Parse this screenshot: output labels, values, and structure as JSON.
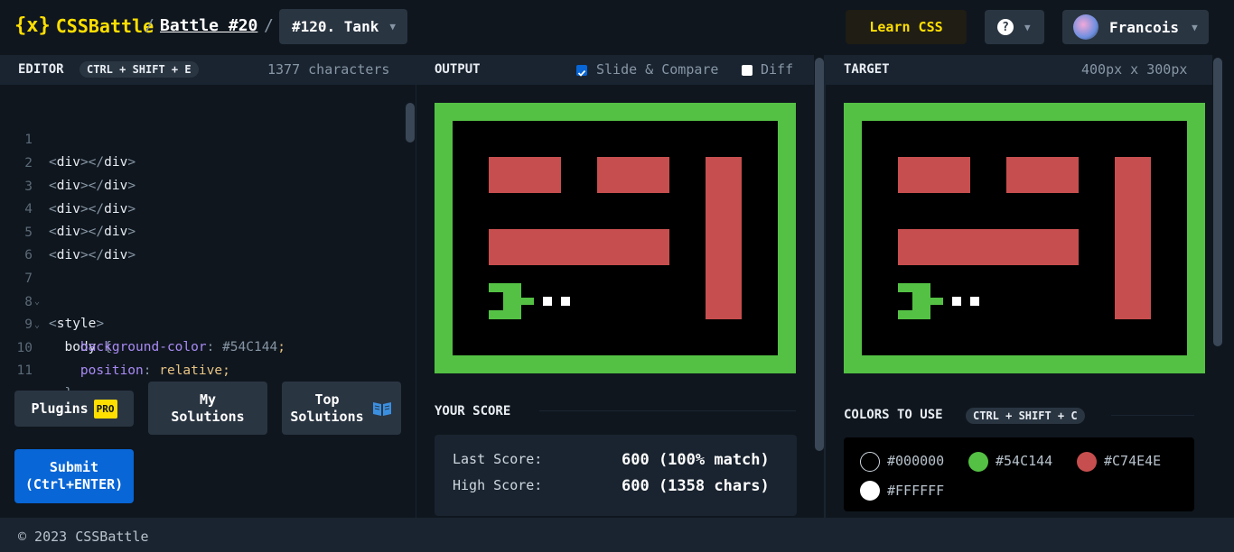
{
  "header": {
    "logo_mark": "{x}",
    "logo_text": "CSSBattle",
    "separator": "/",
    "battle_link": "Battle #20",
    "target_select": "#120. Tank",
    "learn_css": "Learn CSS",
    "help_icon": "?",
    "user_name": "Francois"
  },
  "editor": {
    "title": "EDITOR",
    "shortcut": "CTRL + SHIFT + E",
    "char_count": "1377 characters",
    "lines": [
      {
        "n": "1",
        "tag": "div"
      },
      {
        "n": "2",
        "tag": "div"
      },
      {
        "n": "3",
        "tag": "div"
      },
      {
        "n": "4",
        "tag": "div"
      },
      {
        "n": "5",
        "tag": "div"
      },
      {
        "n": "6"
      },
      {
        "n": "7",
        "style_open": "style"
      },
      {
        "n": "8",
        "selector": "body",
        "brace": "{"
      },
      {
        "n": "9",
        "prop": "background-color",
        "value": "#54C144",
        "end": ";"
      },
      {
        "n": "10",
        "prop": "position",
        "value": "relative",
        "end": ";"
      },
      {
        "n": "11",
        "brace_close": "}"
      }
    ]
  },
  "buttons": {
    "plugins": "Plugins",
    "pro_badge": "PRO",
    "my_solutions_l1": "My",
    "my_solutions_l2": "Solutions",
    "top_solutions_l1": "Top",
    "top_solutions_l2": "Solutions",
    "submit_l1": "Submit",
    "submit_l2": "(Ctrl+ENTER)"
  },
  "output": {
    "title": "OUTPUT",
    "slide_compare": "Slide & Compare",
    "slide_compare_checked": true,
    "diff": "Diff",
    "diff_checked": false
  },
  "target": {
    "title": "TARGET",
    "size": "400px x 300px"
  },
  "score": {
    "title": "YOUR SCORE",
    "last_label": "Last Score:",
    "last_value": "600 (100% match)",
    "high_label": "High Score:",
    "high_value": "600 (1358 chars)"
  },
  "colors": {
    "title": "COLORS TO USE",
    "shortcut": "CTRL + SHIFT + C",
    "swatches": [
      {
        "hex": "#000000",
        "label": "#000000"
      },
      {
        "hex": "#54C144",
        "label": "#54C144"
      },
      {
        "hex": "#C74E4E",
        "label": "#C74E4E"
      },
      {
        "hex": "#FFFFFF",
        "label": "#FFFFFF"
      }
    ]
  },
  "footer": {
    "copyright": "© 2023 CSSBattle"
  },
  "palette": {
    "green": "#54C144",
    "red": "#C74E4E",
    "black": "#000000",
    "white": "#FFFFFF",
    "accent_yellow": "#FFDF00",
    "submit_blue": "#0866D6"
  }
}
